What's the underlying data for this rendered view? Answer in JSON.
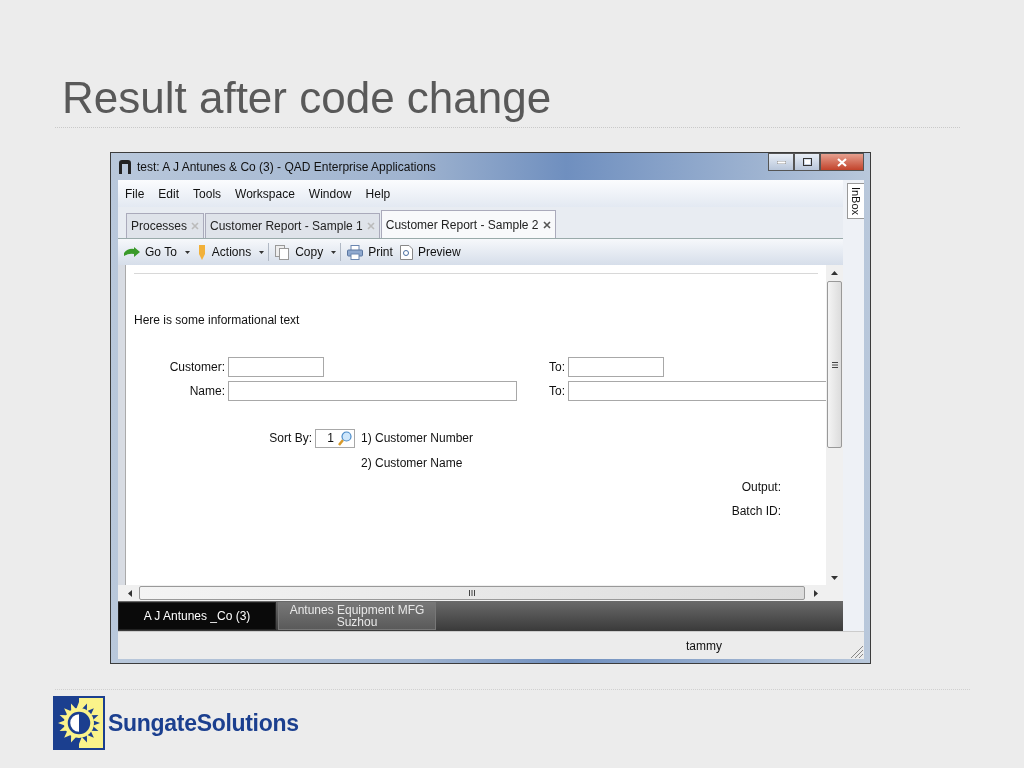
{
  "slide": {
    "title": "Result after code change"
  },
  "window": {
    "title": "test: A J Antunes & Co (3) - QAD Enterprise Applications"
  },
  "menu": [
    {
      "label": "File"
    },
    {
      "label": "Edit"
    },
    {
      "label": "Tools"
    },
    {
      "label": "Workspace"
    },
    {
      "label": "Window"
    },
    {
      "label": "Help"
    }
  ],
  "tabs": [
    {
      "label": "Processes",
      "selected": false
    },
    {
      "label": "Customer Report - Sample 1",
      "selected": false
    },
    {
      "label": "Customer Report - Sample 2",
      "selected": true
    }
  ],
  "toolbar": [
    {
      "label": "Go To",
      "dropdown": true,
      "separator_after": false
    },
    {
      "label": "Actions",
      "dropdown": true,
      "separator_after": true
    },
    {
      "label": "Copy",
      "dropdown": true,
      "separator_after": true
    },
    {
      "label": "Print",
      "dropdown": false,
      "separator_after": false
    },
    {
      "label": "Preview",
      "dropdown": false,
      "separator_after": false
    }
  ],
  "side_tab": {
    "label": "InBox"
  },
  "form": {
    "info": "Here is some informational text",
    "customer_label": "Customer:",
    "customer_to_label": "To:",
    "name_label": "Name:",
    "name_to_label": "To:",
    "sort_label": "Sort By:",
    "sort_value": "1",
    "sort_options": [
      "1) Customer Number",
      "2) Customer Name"
    ],
    "output_label": "Output:",
    "batch_label": "Batch ID:"
  },
  "company_tabs": [
    {
      "label": "A J Antunes _Co (3)",
      "selected": true
    },
    {
      "label": "Antunes Equipment MFG\nSuzhou",
      "selected": false
    }
  ],
  "status_bar": {
    "user": "tammy"
  },
  "logo": {
    "text": "SungateSolutions"
  }
}
